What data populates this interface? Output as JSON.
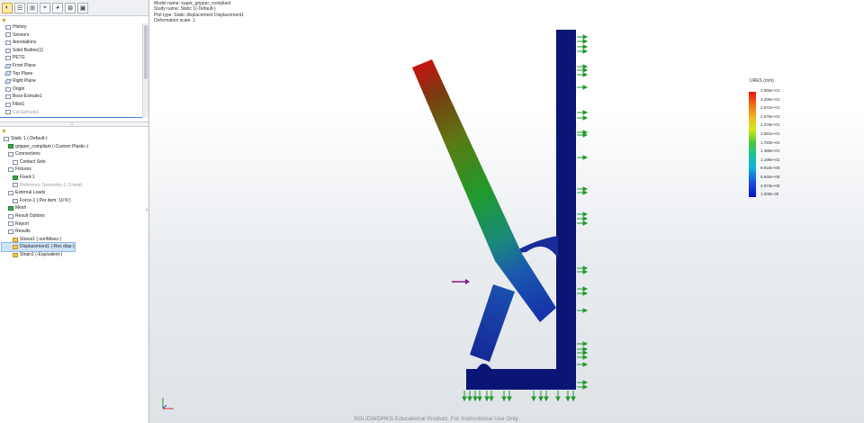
{
  "toolbar": {
    "buttons": [
      {
        "name": "feature-manager-icon",
        "glyph": "◐"
      },
      {
        "name": "property-manager-icon",
        "glyph": "☰"
      },
      {
        "name": "configuration-manager-icon",
        "glyph": "⊞"
      },
      {
        "name": "dimxpert-icon",
        "glyph": "⌖"
      },
      {
        "name": "display-manager-icon",
        "glyph": "◕"
      },
      {
        "name": "simulation-tree-icon",
        "glyph": "⊠"
      },
      {
        "name": "extra-icon",
        "glyph": "▣"
      }
    ]
  },
  "feature_tree": [
    {
      "label": "History",
      "icon": "doc",
      "grey": false
    },
    {
      "label": "Sensors",
      "icon": "doc",
      "grey": false
    },
    {
      "label": "Annotations",
      "icon": "doc",
      "grey": false
    },
    {
      "label": "Solid Bodies(1)",
      "icon": "doc",
      "grey": false
    },
    {
      "label": "PETG",
      "icon": "doc",
      "grey": false
    },
    {
      "label": "Front Plane",
      "icon": "plane",
      "grey": false
    },
    {
      "label": "Top Plane",
      "icon": "plane",
      "grey": false
    },
    {
      "label": "Right Plane",
      "icon": "plane",
      "grey": false
    },
    {
      "label": "Origin",
      "icon": "doc",
      "grey": false
    },
    {
      "label": "Boss-Extrude1",
      "icon": "doc",
      "grey": false
    },
    {
      "label": "Fillet1",
      "icon": "doc",
      "grey": false
    },
    {
      "label": "Cut-Extrude1",
      "icon": "doc",
      "grey": true
    }
  ],
  "sim_tree": [
    {
      "label": "Static 1 (-Default-)",
      "icon": "doc",
      "indent": 0,
      "grey": false,
      "selected": false
    },
    {
      "label": "gripper_compliant (-Custom Plastic-)",
      "icon": "green",
      "indent": 1,
      "grey": false,
      "selected": false
    },
    {
      "label": "Connections",
      "icon": "doc",
      "indent": 1,
      "grey": false,
      "selected": false
    },
    {
      "label": "Contact Sets",
      "icon": "doc",
      "indent": 2,
      "grey": false,
      "selected": false
    },
    {
      "label": "Fixtures",
      "icon": "doc",
      "indent": 1,
      "grey": false,
      "selected": false
    },
    {
      "label": "Fixed-1",
      "icon": "green",
      "indent": 2,
      "grey": false,
      "selected": false
    },
    {
      "label": "Reference Geometry-1 (:Fixed)",
      "icon": "doc",
      "indent": 2,
      "grey": true,
      "selected": false
    },
    {
      "label": "External Loads",
      "icon": "doc",
      "indent": 1,
      "grey": false,
      "selected": false
    },
    {
      "label": "Force-1 (:Per item: 10 N:)",
      "icon": "doc",
      "indent": 2,
      "grey": false,
      "selected": false
    },
    {
      "label": "Mesh",
      "icon": "green",
      "indent": 1,
      "grey": false,
      "selected": false
    },
    {
      "label": "Result Options",
      "icon": "doc",
      "indent": 1,
      "grey": false,
      "selected": false
    },
    {
      "label": "Report",
      "icon": "doc",
      "indent": 1,
      "grey": false,
      "selected": false
    },
    {
      "label": "Results",
      "icon": "doc",
      "indent": 1,
      "grey": false,
      "selected": false
    },
    {
      "label": "Stress1 (-vonMises-)",
      "icon": "yellow",
      "indent": 2,
      "grey": false,
      "selected": false
    },
    {
      "label": "Displacement1 (-Res disp-)",
      "icon": "yellow",
      "indent": 2,
      "grey": false,
      "selected": true
    },
    {
      "label": "Strain1 (-Equivalent-)",
      "icon": "yellow",
      "indent": 2,
      "grey": false,
      "selected": false
    }
  ],
  "viewport_info": [
    "Model name: super_gripper_compliant",
    "Study name: Static 1(-Default-)",
    "Plot type: Static displacement Displacement1",
    "Deformation scale: 1"
  ],
  "legend": {
    "title": "URES (mm)",
    "ticks": [
      "3.566e+01",
      "3.269e+01",
      "2.972e+01",
      "2.675e+01",
      "2.378e+01",
      "2.081e+01",
      "1.783e+01",
      "1.486e+01",
      "1.189e+01",
      "8.918e+00",
      "5.945e+00",
      "2.973e+00",
      "1.000e-30"
    ]
  },
  "watermark": "SOLIDWORKS Educational Product. For Instructional Use Only.",
  "colors": {
    "part_blue": "#0b1575",
    "fixture_green": "#1f9a2a",
    "load_purple": "#7d1a8c",
    "selection": "#cfe3fb"
  }
}
